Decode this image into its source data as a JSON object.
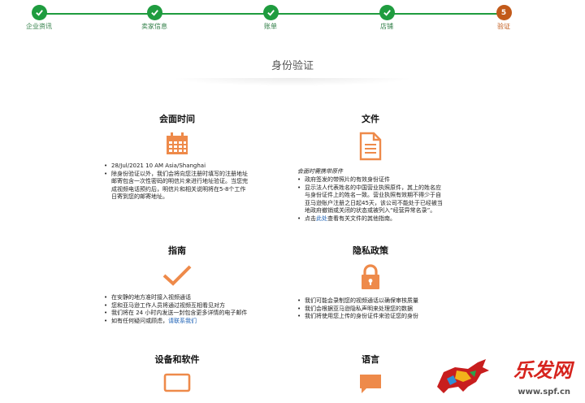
{
  "steps": [
    {
      "label": "企业资讯",
      "state": "done"
    },
    {
      "label": "卖家信息",
      "state": "done"
    },
    {
      "label": "账单",
      "state": "done"
    },
    {
      "label": "店铺",
      "state": "done"
    },
    {
      "label": "验证",
      "state": "current",
      "number": "5"
    }
  ],
  "page_title": "身份验证",
  "sections": {
    "meeting_time": {
      "title": "会面时间",
      "icon": "calendar-icon",
      "bullets": [
        "28/Jul/2021 10 AM Asia/Shanghai",
        "除身份验证以外，我们会将向您注册时填写的注册地址邮寄包含一次性密码的明信片来进行地址验证。当您完成视频电话预约后，明信片和相关说明将在5-8个工作日寄到您的邮寄地址。"
      ]
    },
    "documents": {
      "title": "文件",
      "icon": "document-icon",
      "note": "会面时需携带原件",
      "bullets": [
        "政府签发的带照片的有效身份证件",
        "显示法人代表姓名的中国营业执照原件，其上的姓名应与身份证件上的姓名一致。营业执照有效期不得少于自亚马逊账户注册之日起45天，该公司不能处于已经被当地政府撤销或关闭的状态或被列入“经营异常名录”。"
      ],
      "link_prefix": "点击",
      "link_text": "此处",
      "link_suffix": "查看有关文件的其他指南。"
    },
    "guide": {
      "title": "指南",
      "icon": "checkmark-icon",
      "bullets": [
        "在安静的地方准时接入视频通话",
        "您和亚马逊工作人员将通过视频互相看见对方",
        "我们将在 24 小时内发送一封包含更多详情的电子邮件"
      ],
      "contact_prefix": "如有任何疑问或顾虑，",
      "contact_link": "请联系我们"
    },
    "privacy": {
      "title": "隐私政策",
      "icon": "lock-icon",
      "bullets": [
        "我们可能会录制您的视频通话以确保审核质量",
        "我们会根据亚马逊隐私声明来处理您的数据",
        "我们将使用您上传的身份证件来验证您的身份"
      ]
    },
    "devices": {
      "title": "设备和软件",
      "icon": "monitor-icon"
    },
    "language": {
      "title": "语言",
      "icon": "chat-bubble-icon"
    }
  },
  "watermark": {
    "brand": "乐发网",
    "url": "www.spf.cn"
  },
  "colors": {
    "step_done": "#1f9c3f",
    "step_current": "#c25a1a",
    "icon_orange": "#ee8a4a",
    "link": "#1a5fb4"
  }
}
